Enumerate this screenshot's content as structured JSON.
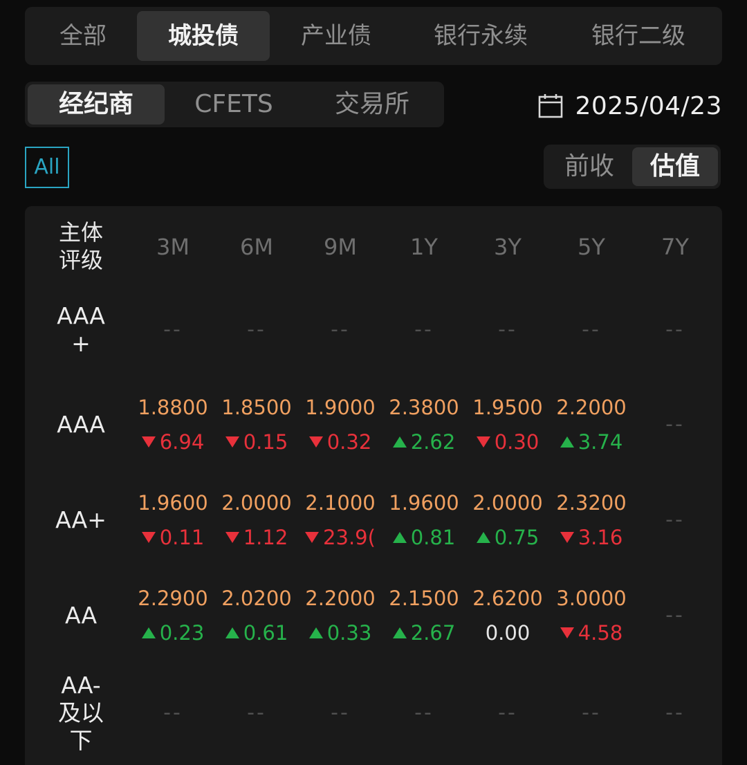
{
  "category_tabs": [
    {
      "label": "全部",
      "active": false
    },
    {
      "label": "城投债",
      "active": true
    },
    {
      "label": "产业债",
      "active": false
    },
    {
      "label": "银行永续",
      "active": false
    },
    {
      "label": "银行二级",
      "active": false
    }
  ],
  "source_tabs": [
    {
      "label": "经纪商",
      "active": true
    },
    {
      "label": "CFETS",
      "active": false
    },
    {
      "label": "交易所",
      "active": false
    }
  ],
  "date": {
    "icon": "calendar-icon",
    "value": "2025/04/23"
  },
  "filter": {
    "all_label": "All"
  },
  "price_mode": [
    {
      "label": "前收",
      "active": false
    },
    {
      "label": "估值",
      "active": true
    }
  ],
  "colors": {
    "up": "#26b24b",
    "down": "#e8313b",
    "value": "#f0a060",
    "accent": "#2aa5c2"
  },
  "table": {
    "corner_label": [
      "主体",
      "评级"
    ],
    "columns": [
      "3M",
      "6M",
      "9M",
      "1Y",
      "3Y",
      "5Y",
      "7Y"
    ],
    "empty_text": "--",
    "rows": [
      {
        "label": [
          "AAA",
          "+"
        ],
        "cells": [
          null,
          null,
          null,
          null,
          null,
          null,
          null
        ]
      },
      {
        "label": [
          "AAA"
        ],
        "cells": [
          {
            "value": "1.8800",
            "change": "6.94",
            "dir": "down"
          },
          {
            "value": "1.8500",
            "change": "0.15",
            "dir": "down"
          },
          {
            "value": "1.9000",
            "change": "0.32",
            "dir": "down"
          },
          {
            "value": "2.3800",
            "change": "2.62",
            "dir": "up"
          },
          {
            "value": "1.9500",
            "change": "0.30",
            "dir": "down"
          },
          {
            "value": "2.2000",
            "change": "3.74",
            "dir": "up"
          },
          null
        ]
      },
      {
        "label": [
          "AA+"
        ],
        "cells": [
          {
            "value": "1.9600",
            "change": "0.11",
            "dir": "down"
          },
          {
            "value": "2.0000",
            "change": "1.12",
            "dir": "down"
          },
          {
            "value": "2.1000",
            "change": "23.9(",
            "dir": "down"
          },
          {
            "value": "1.9600",
            "change": "0.81",
            "dir": "up"
          },
          {
            "value": "2.0000",
            "change": "0.75",
            "dir": "up"
          },
          {
            "value": "2.3200",
            "change": "3.16",
            "dir": "down"
          },
          null
        ]
      },
      {
        "label": [
          "AA"
        ],
        "cells": [
          {
            "value": "2.2900",
            "change": "0.23",
            "dir": "up"
          },
          {
            "value": "2.0200",
            "change": "0.61",
            "dir": "up"
          },
          {
            "value": "2.2000",
            "change": "0.33",
            "dir": "up"
          },
          {
            "value": "2.1500",
            "change": "2.67",
            "dir": "up"
          },
          {
            "value": "2.6200",
            "change": "0.00",
            "dir": "flat"
          },
          {
            "value": "3.0000",
            "change": "4.58",
            "dir": "down"
          },
          null
        ]
      },
      {
        "label": [
          "AA-",
          "及以",
          "下"
        ],
        "cells": [
          null,
          null,
          null,
          null,
          null,
          null,
          null
        ]
      }
    ]
  }
}
